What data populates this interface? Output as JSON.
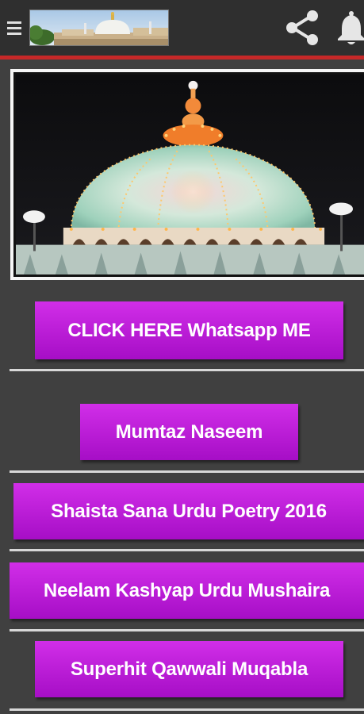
{
  "header": {
    "menu_icon": "hamburger-menu-icon",
    "logo": "shrine-dome-logo",
    "share_icon": "share-icon",
    "notification_icon": "bell-icon",
    "accent_color": "#c62828"
  },
  "hero": {
    "image": "illuminated-shrine-dome-at-night"
  },
  "buttons": [
    {
      "label": "CLICK HERE Whatsapp ME"
    },
    {
      "label": "Mumtaz Naseem"
    },
    {
      "label": "Shaista Sana Urdu Poetry 2016"
    },
    {
      "label": "Neelam Kashyap Urdu Mushaira"
    },
    {
      "label": "Superhit Qawwali Muqabla"
    }
  ],
  "colors": {
    "button_purple": "#b81ad6",
    "background": "#404040",
    "divider": "#d8d8d8"
  }
}
